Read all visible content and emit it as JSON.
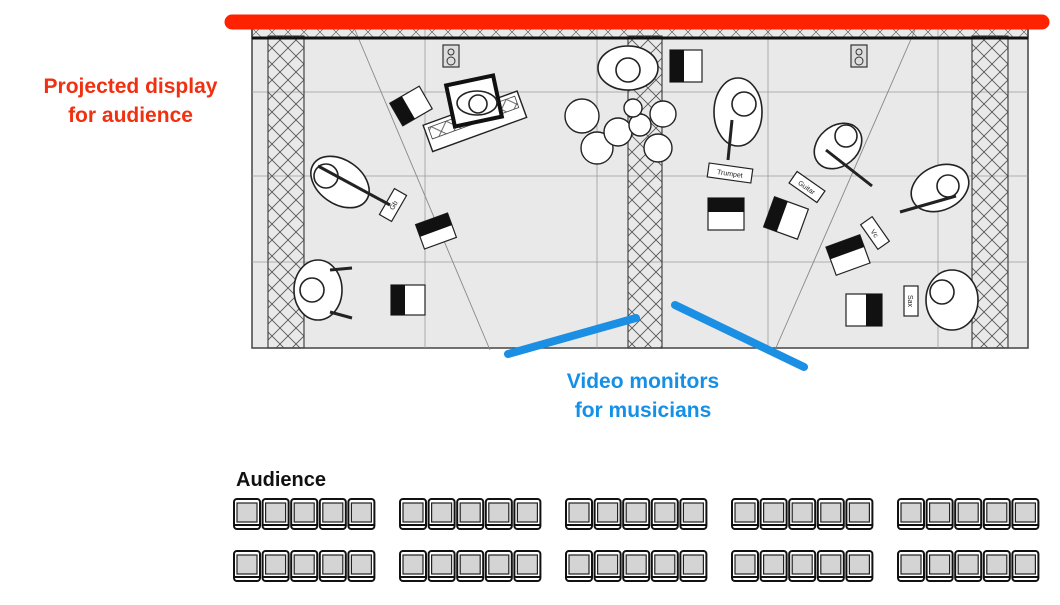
{
  "labels": {
    "projected_display": [
      "Projected display",
      "for audience"
    ],
    "video_monitors": [
      "Video monitors",
      "for musicians"
    ],
    "audience": "Audience"
  },
  "instrument_tags": [
    "Trumpet",
    "Guitar",
    "Vc",
    "Sax",
    "Gb"
  ],
  "seating": {
    "rows": 2,
    "blocks_per_row": 5,
    "seats_per_block": 5
  },
  "colors": {
    "projection": "#ff2200",
    "projection_text": "#f03010",
    "monitor": "#1a8fe3",
    "monitor_text": "#1490e6",
    "stage_floor": "#e9e9e9",
    "line": "#333333"
  }
}
